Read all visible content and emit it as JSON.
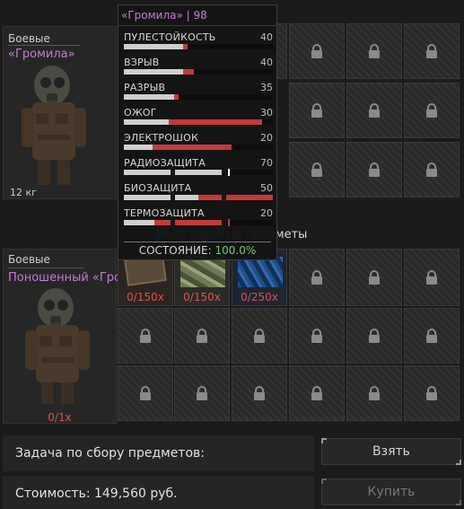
{
  "equipped": {
    "type_label": "Боевые",
    "name": "«Громила»",
    "weight": "12 кг"
  },
  "tooltip": {
    "title": "«Громила»",
    "level": "| 98",
    "stats": [
      {
        "label": "ПУЛЕСТОЙКОСТЬ",
        "value": "40"
      },
      {
        "label": "ВЗРЫВ",
        "value": "40"
      },
      {
        "label": "РАЗРЫВ",
        "value": "35"
      },
      {
        "label": "ОЖОГ",
        "value": "30"
      },
      {
        "label": "ЭЛЕКТРОШОК",
        "value": "20"
      },
      {
        "label": "РАДИОЗАЩИТА",
        "value": "70"
      },
      {
        "label": "БИОЗАЩИТА",
        "value": "50"
      },
      {
        "label": "ТЕРМОЗАЩИТА",
        "value": "20"
      }
    ],
    "condition_label": "СОСТОЯНИЕ:",
    "condition_value": "100.0%"
  },
  "section_heading": "Необходимые предметы",
  "required_items": [
    {
      "count": "0/150x"
    },
    {
      "count": "0/150x"
    },
    {
      "count": "0/250x"
    }
  ],
  "target": {
    "type_label": "Боевые",
    "name": "Поношенный «Гро...",
    "count": "0/1x"
  },
  "task_label": "Задача по сбору предметов:",
  "cost_label": "Стоимость: 149,560 руб.",
  "buttons": {
    "take": "Взять",
    "buy": "Купить"
  },
  "colors": {
    "accent_purple": "#c77ad6",
    "count_red": "#d9534f",
    "condition_green": "#69c96b",
    "bar_red": "#c43a3a"
  }
}
